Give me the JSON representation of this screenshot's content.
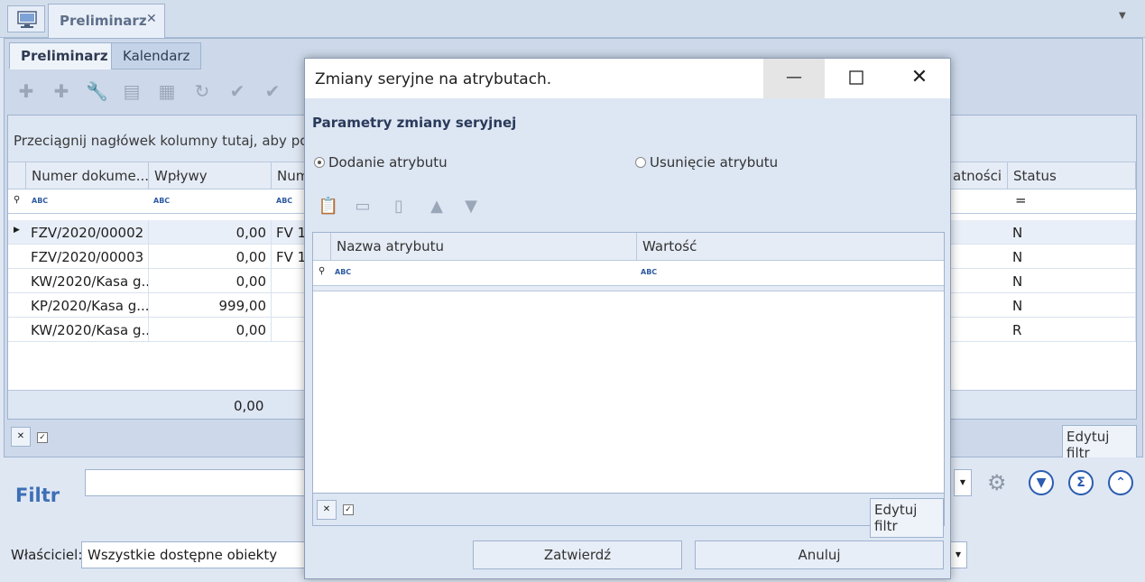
{
  "window": {
    "doc_tab_label": "Preliminarz",
    "doc_tab_close": "✕"
  },
  "tabs": [
    "Preliminarz",
    "Kalendarz"
  ],
  "grid": {
    "group_hint": "Przeciągnij nagłówek kolumny tutaj, aby pogrupować",
    "columns": [
      "Numer dokume...",
      "Wpływy",
      "Num",
      "atności",
      "Status"
    ],
    "rows": [
      {
        "numer": "FZV/2020/00002",
        "wplywy": "0,00",
        "num": "FV 1",
        "status": "N"
      },
      {
        "numer": "FZV/2020/00003",
        "wplywy": "0,00",
        "num": "FV 1",
        "status": "N"
      },
      {
        "numer": "KW/2020/Kasa g...",
        "wplywy": "0,00",
        "num": "",
        "status": "N"
      },
      {
        "numer": "KP/2020/Kasa g...",
        "wplywy": "999,00",
        "num": "",
        "status": "N"
      },
      {
        "numer": "KW/2020/Kasa g...",
        "wplywy": "0,00",
        "num": "",
        "status": "R"
      }
    ],
    "sum_wplywy": "0,00",
    "status_filter_symbol": "="
  },
  "bottom_bar": {
    "edit_filter": "Edytuj filtr"
  },
  "filter": {
    "label": "Filtr",
    "owner_label": "Właściciel:",
    "owner_value": "Wszystkie dostępne obiekty"
  },
  "dialog": {
    "title": "Zmiany seryjne na atrybutach.",
    "params_title": "Parametry zmiany seryjnej",
    "radio_add": "Dodanie atrybutu",
    "radio_remove": "Usunięcie atrybutu",
    "columns": [
      "Nazwa atrybutu",
      "Wartość"
    ],
    "edit_filter": "Edytuj filtr",
    "confirm": "Zatwierdź",
    "cancel": "Anuluj"
  },
  "filter_icon_text": "ABC"
}
